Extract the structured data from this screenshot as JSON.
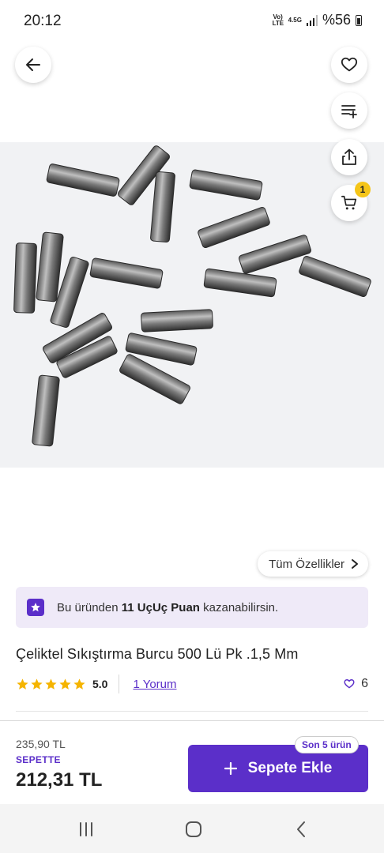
{
  "status_bar": {
    "time": "20:12",
    "network_top": "Vo) LTE",
    "network_4g": "4.5G",
    "battery": "%56"
  },
  "colors": {
    "brand": "#5b2fc9",
    "banner_bg": "#efeaf8",
    "star": "#f5b400",
    "cart_badge": "#f5c518"
  },
  "header": {
    "back_icon": "arrow-left-icon",
    "actions": [
      {
        "icon": "heart-outline-icon"
      },
      {
        "icon": "list-add-icon"
      },
      {
        "icon": "share-icon"
      },
      {
        "icon": "cart-icon",
        "badge": "1"
      }
    ]
  },
  "product": {
    "image_alt": "steel pins",
    "all_features_label": "Tüm Özellikler",
    "title": "Çeliktel Sıkıştırma Burcu 500 Lü Pk .1,5 Mm",
    "rating": "5.0",
    "stars": 5,
    "reviews_label": "1 Yorum",
    "likes": "6"
  },
  "points_banner": {
    "prefix": "Bu üründen",
    "bold": "11 UçUç Puan",
    "suffix": "kazanabilirsin."
  },
  "pricing": {
    "old_price": "235,90 TL",
    "cart_label": "SEPETTE",
    "price": "212,31 TL"
  },
  "cta": {
    "label": "Sepete Ekle",
    "stock_badge": "Son 5 ürün"
  },
  "nav": {
    "recents_icon": "recents-icon",
    "home_icon": "home-icon",
    "back_icon": "back-icon"
  }
}
